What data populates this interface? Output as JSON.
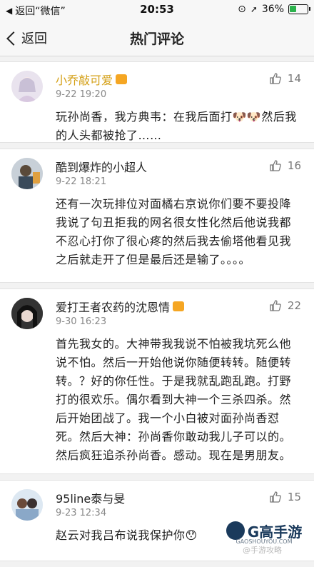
{
  "status_bar": {
    "back_app": "返回“微信”",
    "time": "20:53",
    "battery_percent": "36%",
    "battery_level": 0.36,
    "battery_color": "#2bb24c"
  },
  "nav": {
    "back_label": "返回",
    "title": "热门评论"
  },
  "comments": [
    {
      "username": "小乔敲可爱",
      "username_color": "#d4a017",
      "time": "9-22 19:20",
      "likes": "14",
      "text": "玩孙尚香，我方典韦：在我后面打🐶🐶然后我的人头都被抢了……"
    },
    {
      "username": "酷到爆炸的小超人",
      "username_color": "#222222",
      "time": "9-22 18:21",
      "likes": "16",
      "text": "还有一次玩排位对面橘右京说你们要不要投降我说了句丑拒我的网名很女性化然后他说我都不忍心打你了很心疼的然后我去偷塔他看见我之后就走开了但是最后还是输了。。。。"
    },
    {
      "username": "爱打王者农药的沈恩情",
      "username_color": "#222222",
      "time": "9-30 16:23",
      "likes": "22",
      "text": "首先我女的。大神带我我说不怕被我坑死么他说不怕。然后一开始他说你随便转转。随便转转。？好的你任性。于是我就乱跑乱跑。打野打的很欢乐。偶尔看到大神一个三杀四杀。然后开始团战了。我一个小白被对面孙尚香怼死。然后大神：孙尚香你敢动我儿子可以的。然后疯狂追杀孙尚香。感动。现在是男朋友。"
    },
    {
      "username": "95line泰与旻",
      "username_color": "#222222",
      "time": "9-23 12:34",
      "likes": "15",
      "text": "赵云对我吕布说我保护你😯"
    }
  ],
  "watermark": {
    "brand": "G高手游",
    "url": "GAOSHOUYOU.COM",
    "weibo": "@手游攻略"
  }
}
